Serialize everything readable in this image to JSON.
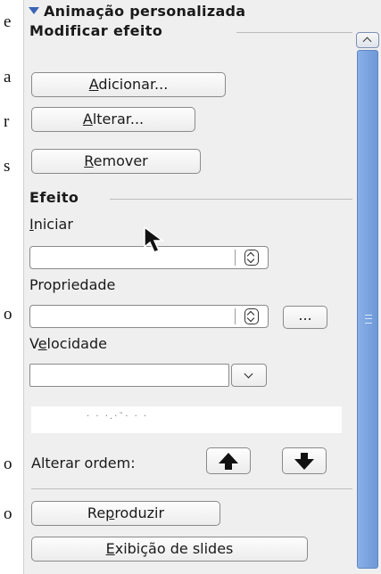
{
  "document_strip": {
    "letters": [
      "e",
      "a",
      "r",
      "s",
      "o",
      "o",
      "o"
    ]
  },
  "panel": {
    "title": "Animação personalizada",
    "modify_section": {
      "title": "Modificar efeito",
      "add_prefix": "",
      "add_mnemonic": "A",
      "add_rest": "dicionar...",
      "change_mnemonic": "A",
      "change_rest": "lterar...",
      "remove_mnemonic": "R",
      "remove_rest": "emover"
    },
    "effect_section": {
      "title": "Efeito",
      "start_mnemonic": "I",
      "start_rest": "niciar",
      "start_value": "",
      "property_label": "Propriedade",
      "property_value": "",
      "more_button": "...",
      "speed_prefix": "V",
      "speed_mnemonic": "e",
      "speed_rest": "locidade",
      "speed_value": ""
    },
    "change_order_label": "Alterar ordem:",
    "play_prefix": "Re",
    "play_mnemonic": "p",
    "play_rest": "roduzir",
    "slideshow_mnemonic": "E",
    "slideshow_rest": "xibição de slides"
  },
  "icons": {
    "move_up": "arrow-up-icon",
    "move_down": "arrow-down-icon",
    "collapse": "triangle-down-icon"
  },
  "colors": {
    "panel_bg": "#efefef",
    "accent": "#3b64b4",
    "scrollbar": "#7aa4e0"
  }
}
